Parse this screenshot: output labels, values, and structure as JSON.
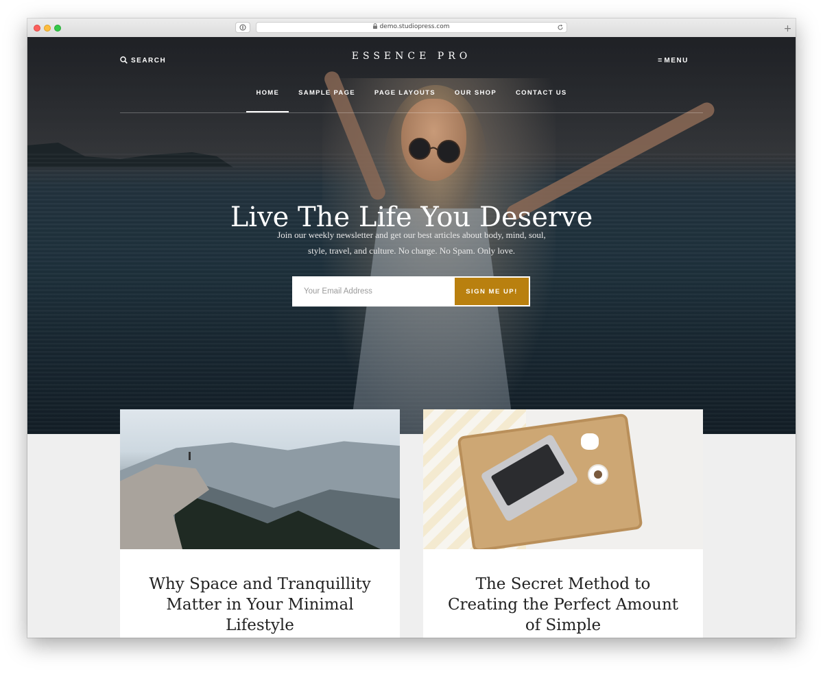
{
  "browser": {
    "url": "demo.studiopress.com",
    "new_tab_glyph": "+"
  },
  "header": {
    "search_label": "SEARCH",
    "brand": "ESSENCE PRO",
    "menu_label": "MENU"
  },
  "nav": {
    "items": [
      {
        "label": "HOME",
        "active": true
      },
      {
        "label": "SAMPLE PAGE"
      },
      {
        "label": "PAGE LAYOUTS"
      },
      {
        "label": "OUR SHOP"
      },
      {
        "label": "CONTACT US"
      }
    ]
  },
  "hero": {
    "title": "Live The Life You Deserve",
    "subtitle": "Join our weekly newsletter and get our best articles about body, mind, soul, style, travel, and culture. No charge. No Spam. Only love.",
    "email_placeholder": "Your Email Address",
    "button_label": "SIGN ME UP!"
  },
  "colors": {
    "accent": "#b9800f"
  },
  "posts": [
    {
      "title": "Why Space and Tranquillity Matter in Your Minimal Lifestyle"
    },
    {
      "title": "The Secret Method to Creating the Perfect Amount of Simple"
    }
  ]
}
